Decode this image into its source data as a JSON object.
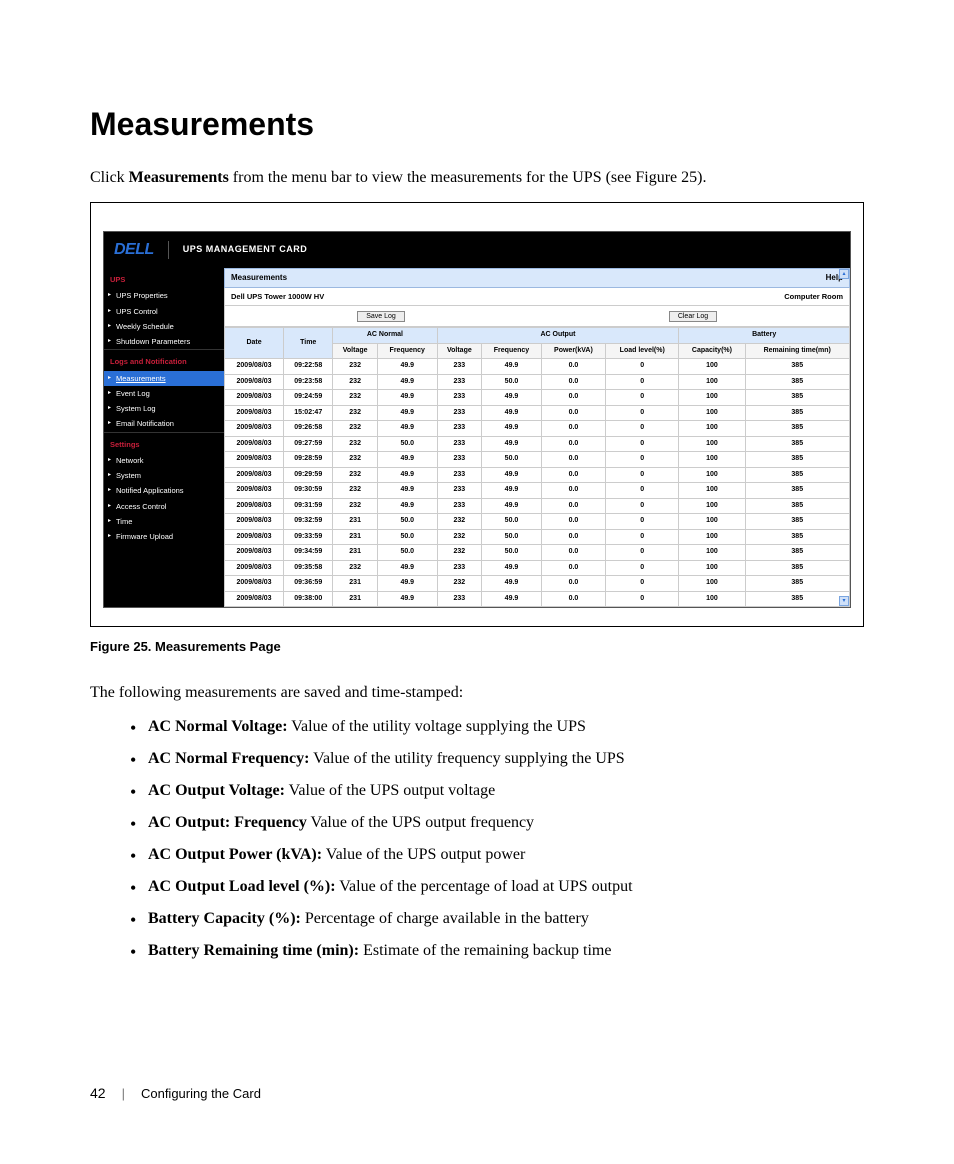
{
  "heading": "Measurements",
  "intro_pre": "Click ",
  "intro_bold": "Measurements",
  "intro_post": " from the menu bar to view the measurements for the UPS (see Figure 25).",
  "app": {
    "logo": "DELL",
    "card_title": "UPS MANAGEMENT CARD",
    "sidebar": {
      "sections": [
        {
          "title": "UPS",
          "items": [
            "UPS Properties",
            "UPS Control",
            "Weekly Schedule",
            "Shutdown Parameters"
          ]
        },
        {
          "title": "Logs and Notification",
          "items": [
            "Measurements",
            "Event Log",
            "System Log",
            "Email Notification"
          ]
        },
        {
          "title": "Settings",
          "items": [
            "Network",
            "System",
            "Notified Applications",
            "Access Control",
            "Time",
            "Firmware Upload"
          ]
        }
      ],
      "active": "Measurements"
    },
    "panel_title": "Measurements",
    "help_label": "Help",
    "device_name": "Dell UPS Tower 1000W HV",
    "location": "Computer Room",
    "buttons": {
      "save": "Save Log",
      "clear": "Clear Log"
    },
    "columns": {
      "date": "Date",
      "time": "Time",
      "ac_normal": "AC Normal",
      "ac_output": "AC Output",
      "battery": "Battery",
      "voltage": "Voltage",
      "frequency": "Frequency",
      "power": "Power(kVA)",
      "load": "Load level(%)",
      "capacity": "Capacity(%)",
      "remaining": "Remaining time(mn)"
    },
    "rows": [
      {
        "date": "2009/08/03",
        "time": "09:22:58",
        "anV": "232",
        "anF": "49.9",
        "aoV": "233",
        "aoF": "49.9",
        "pwr": "0.0",
        "load": "0",
        "cap": "100",
        "rem": "385"
      },
      {
        "date": "2009/08/03",
        "time": "09:23:58",
        "anV": "232",
        "anF": "49.9",
        "aoV": "233",
        "aoF": "50.0",
        "pwr": "0.0",
        "load": "0",
        "cap": "100",
        "rem": "385"
      },
      {
        "date": "2009/08/03",
        "time": "09:24:59",
        "anV": "232",
        "anF": "49.9",
        "aoV": "233",
        "aoF": "49.9",
        "pwr": "0.0",
        "load": "0",
        "cap": "100",
        "rem": "385"
      },
      {
        "date": "2009/08/03",
        "time": "15:02:47",
        "anV": "232",
        "anF": "49.9",
        "aoV": "233",
        "aoF": "49.9",
        "pwr": "0.0",
        "load": "0",
        "cap": "100",
        "rem": "385"
      },
      {
        "date": "2009/08/03",
        "time": "09:26:58",
        "anV": "232",
        "anF": "49.9",
        "aoV": "233",
        "aoF": "49.9",
        "pwr": "0.0",
        "load": "0",
        "cap": "100",
        "rem": "385"
      },
      {
        "date": "2009/08/03",
        "time": "09:27:59",
        "anV": "232",
        "anF": "50.0",
        "aoV": "233",
        "aoF": "49.9",
        "pwr": "0.0",
        "load": "0",
        "cap": "100",
        "rem": "385"
      },
      {
        "date": "2009/08/03",
        "time": "09:28:59",
        "anV": "232",
        "anF": "49.9",
        "aoV": "233",
        "aoF": "50.0",
        "pwr": "0.0",
        "load": "0",
        "cap": "100",
        "rem": "385"
      },
      {
        "date": "2009/08/03",
        "time": "09:29:59",
        "anV": "232",
        "anF": "49.9",
        "aoV": "233",
        "aoF": "49.9",
        "pwr": "0.0",
        "load": "0",
        "cap": "100",
        "rem": "385"
      },
      {
        "date": "2009/08/03",
        "time": "09:30:59",
        "anV": "232",
        "anF": "49.9",
        "aoV": "233",
        "aoF": "49.9",
        "pwr": "0.0",
        "load": "0",
        "cap": "100",
        "rem": "385"
      },
      {
        "date": "2009/08/03",
        "time": "09:31:59",
        "anV": "232",
        "anF": "49.9",
        "aoV": "233",
        "aoF": "49.9",
        "pwr": "0.0",
        "load": "0",
        "cap": "100",
        "rem": "385"
      },
      {
        "date": "2009/08/03",
        "time": "09:32:59",
        "anV": "231",
        "anF": "50.0",
        "aoV": "232",
        "aoF": "50.0",
        "pwr": "0.0",
        "load": "0",
        "cap": "100",
        "rem": "385"
      },
      {
        "date": "2009/08/03",
        "time": "09:33:59",
        "anV": "231",
        "anF": "50.0",
        "aoV": "232",
        "aoF": "50.0",
        "pwr": "0.0",
        "load": "0",
        "cap": "100",
        "rem": "385"
      },
      {
        "date": "2009/08/03",
        "time": "09:34:59",
        "anV": "231",
        "anF": "50.0",
        "aoV": "232",
        "aoF": "50.0",
        "pwr": "0.0",
        "load": "0",
        "cap": "100",
        "rem": "385"
      },
      {
        "date": "2009/08/03",
        "time": "09:35:58",
        "anV": "232",
        "anF": "49.9",
        "aoV": "233",
        "aoF": "49.9",
        "pwr": "0.0",
        "load": "0",
        "cap": "100",
        "rem": "385"
      },
      {
        "date": "2009/08/03",
        "time": "09:36:59",
        "anV": "231",
        "anF": "49.9",
        "aoV": "232",
        "aoF": "49.9",
        "pwr": "0.0",
        "load": "0",
        "cap": "100",
        "rem": "385"
      },
      {
        "date": "2009/08/03",
        "time": "09:38:00",
        "anV": "231",
        "anF": "49.9",
        "aoV": "233",
        "aoF": "49.9",
        "pwr": "0.0",
        "load": "0",
        "cap": "100",
        "rem": "385"
      }
    ]
  },
  "figure_caption": "Figure 25. Measurements Page",
  "followup": "The following measurements are saved and time-stamped:",
  "bullets": [
    {
      "b": "AC Normal Voltage:",
      "t": " Value of the utility voltage supplying the UPS"
    },
    {
      "b": "AC Normal Frequency:",
      "t": " Value of the utility frequency supplying the UPS"
    },
    {
      "b": "AC Output Voltage:",
      "t": " Value of the UPS output voltage"
    },
    {
      "b": "AC Output: Frequency",
      "t": " Value of the UPS output frequency"
    },
    {
      "b": "AC Output Power (kVA):",
      "t": " Value of the UPS output power"
    },
    {
      "b": "AC Output Load level (%):",
      "t": " Value of the percentage of load at UPS output"
    },
    {
      "b": "Battery Capacity (%):",
      "t": " Percentage of charge available in the battery"
    },
    {
      "b": "Battery Remaining time (min):",
      "t": " Estimate of the remaining backup time"
    }
  ],
  "footer": {
    "page": "42",
    "section": "Configuring the Card"
  }
}
